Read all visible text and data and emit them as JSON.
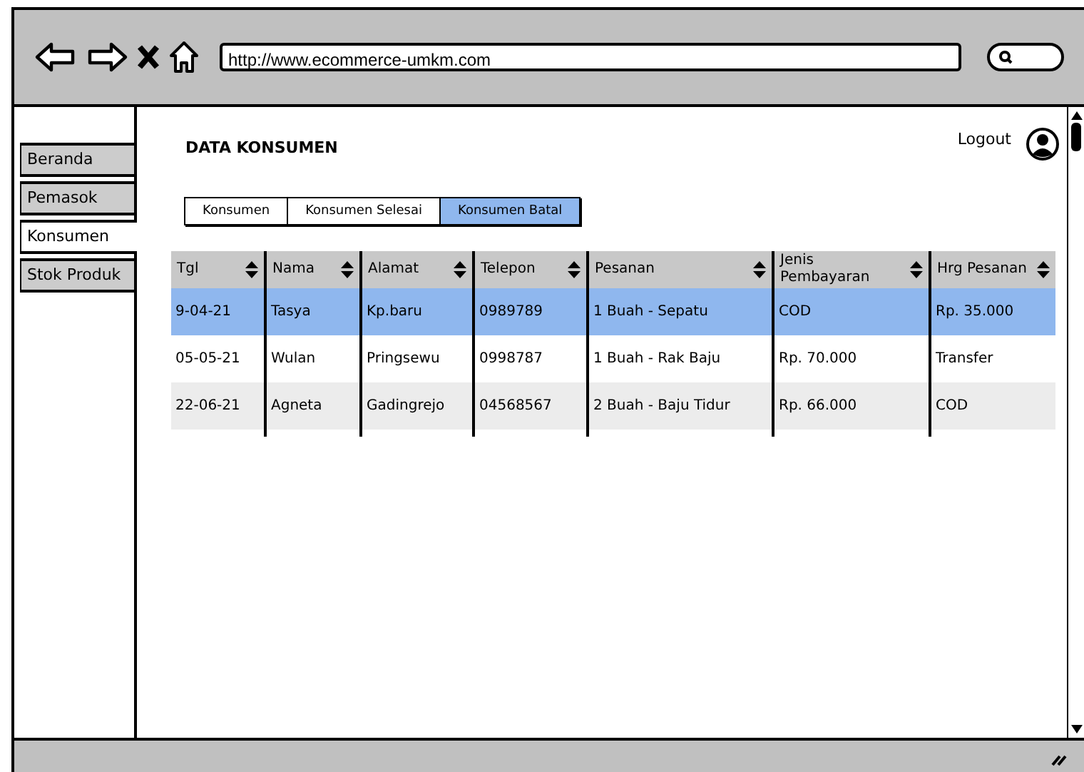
{
  "browser": {
    "url": "http://www.ecommerce-umkm.com"
  },
  "sidebar": {
    "items": [
      {
        "label": "Beranda",
        "selected": false
      },
      {
        "label": "Pemasok",
        "selected": false
      },
      {
        "label": "Konsumen",
        "selected": true
      },
      {
        "label": "Stok Produk",
        "selected": false
      }
    ]
  },
  "header": {
    "title": "DATA KONSUMEN",
    "logout": "Logout"
  },
  "tabs": [
    {
      "label": "Konsumen",
      "selected": false
    },
    {
      "label": "Konsumen Selesai",
      "selected": false
    },
    {
      "label": "Konsumen Batal",
      "selected": true
    }
  ],
  "table": {
    "columns": [
      "Tgl",
      "Nama",
      "Alamat",
      "Telepon",
      "Pesanan",
      "Jenis Pembayaran",
      "Hrg Pesanan"
    ],
    "rows": [
      {
        "selected": true,
        "cells": [
          "9-04-21",
          "Tasya",
          "Kp.baru",
          "0989789",
          "1 Buah - Sepatu",
          "COD",
          "Rp. 35.000"
        ]
      },
      {
        "selected": false,
        "cells": [
          "05-05-21",
          "Wulan",
          "Pringsewu",
          "0998787",
          "1 Buah - Rak Baju",
          "Rp. 70.000",
          "Transfer"
        ]
      },
      {
        "selected": false,
        "cells": [
          "22-06-21",
          "Agneta",
          "Gadingrejo",
          "04568567",
          "2 Buah - Baju Tidur",
          "Rp. 66.000",
          "COD"
        ]
      }
    ]
  }
}
